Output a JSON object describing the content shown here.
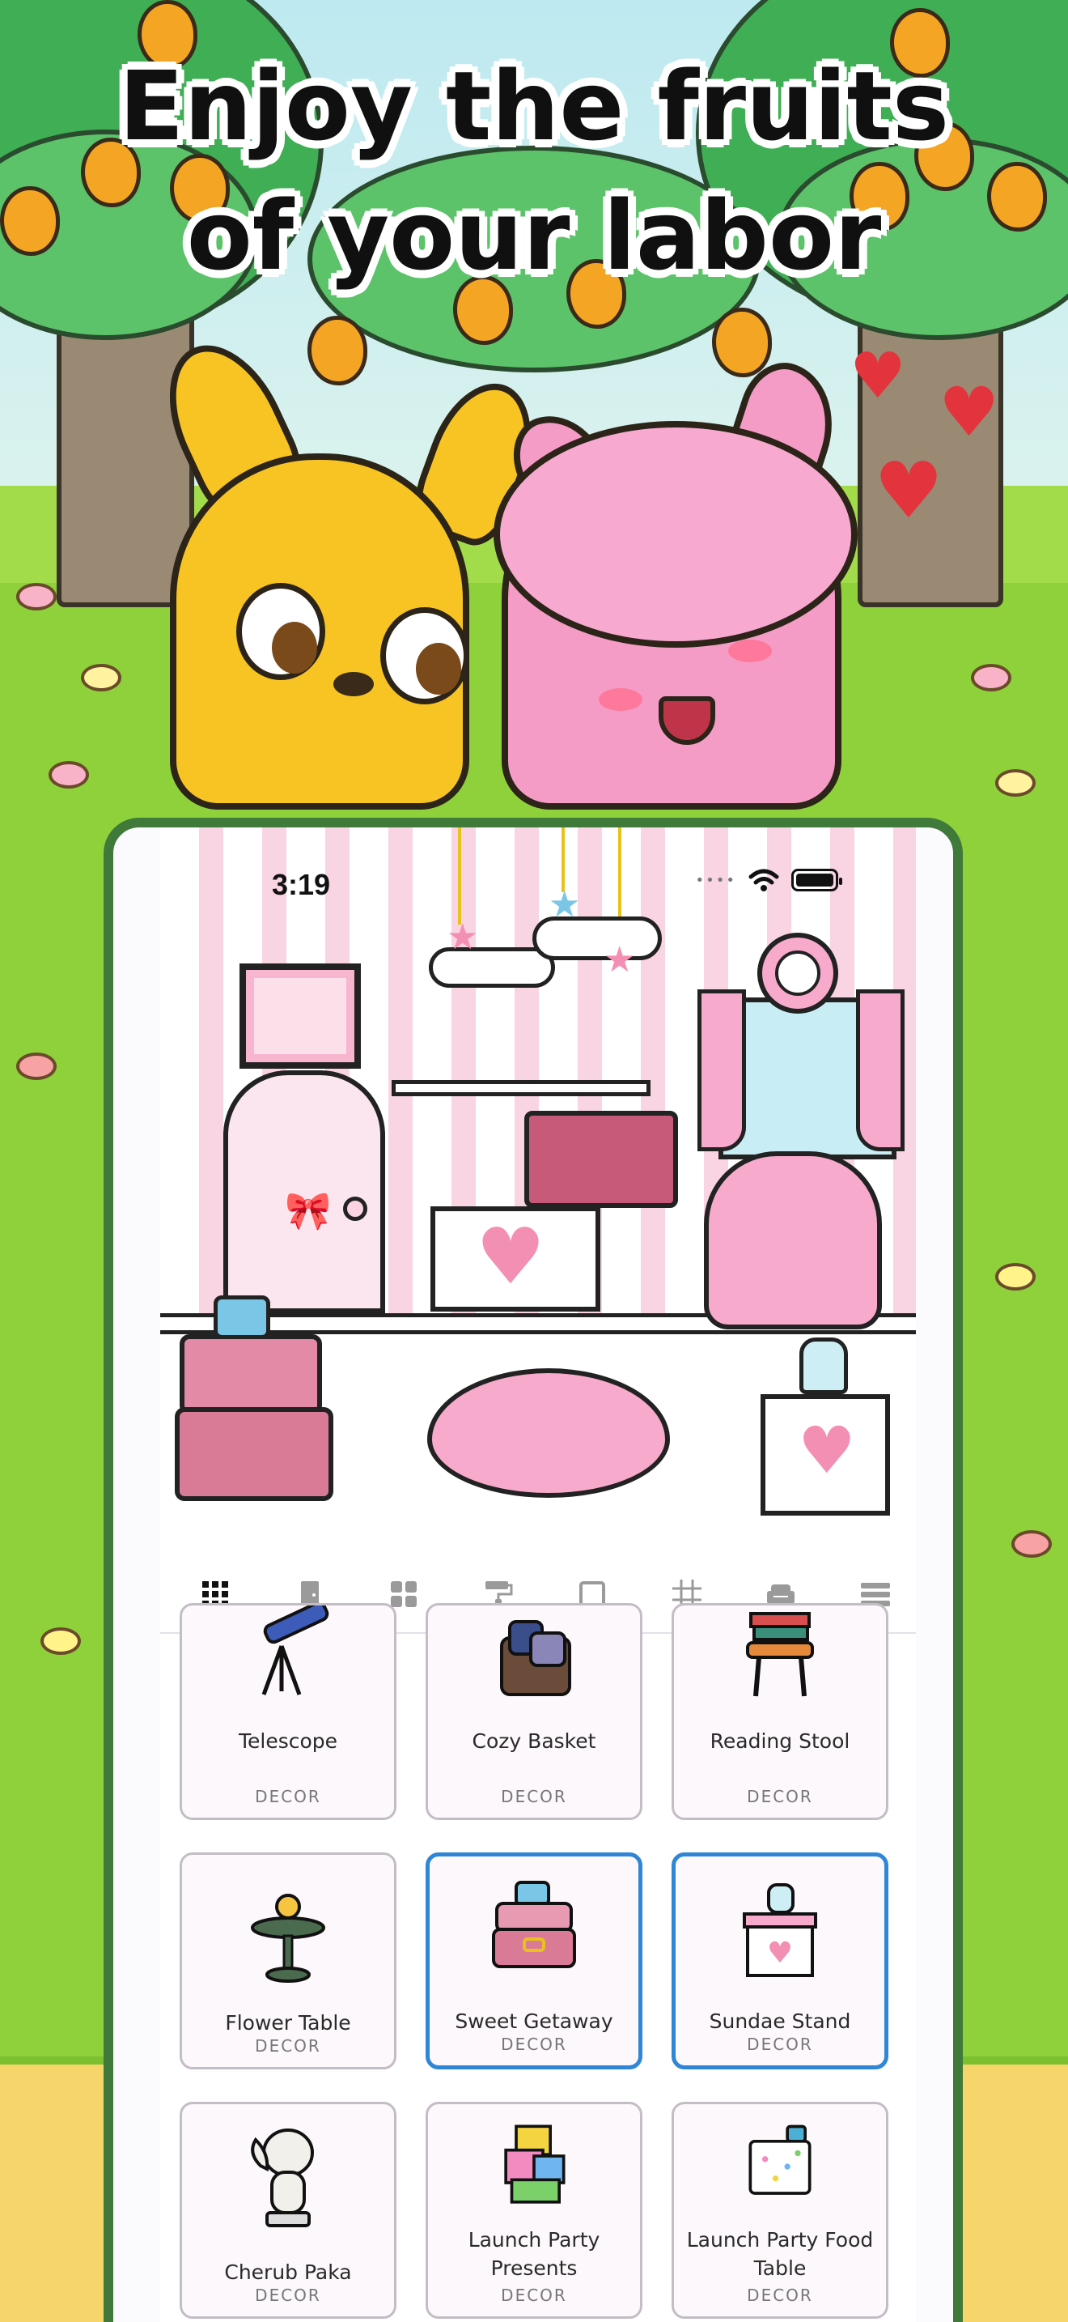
{
  "headline": {
    "line1": "Enjoy the fruits",
    "line2": "of your labor"
  },
  "status_bar": {
    "time": "3:19"
  },
  "tabs": [
    {
      "icon": "grid-icon",
      "selected": true
    },
    {
      "icon": "door-icon",
      "selected": false
    },
    {
      "icon": "window-icon",
      "selected": false
    },
    {
      "icon": "paint-roller-icon",
      "selected": false
    },
    {
      "icon": "square-icon",
      "selected": false
    },
    {
      "icon": "floor-grid-icon",
      "selected": false
    },
    {
      "icon": "sofa-icon",
      "selected": false
    },
    {
      "icon": "list-icon",
      "selected": false
    }
  ],
  "items": [
    {
      "name": "Telescope",
      "category": "DECOR",
      "selected": false
    },
    {
      "name": "Cozy Basket",
      "category": "DECOR",
      "selected": false
    },
    {
      "name": "Reading Stool",
      "category": "DECOR",
      "selected": false
    },
    {
      "name": "Flower Table",
      "category": "DECOR",
      "selected": false
    },
    {
      "name": "Sweet Getaway",
      "category": "DECOR",
      "selected": true
    },
    {
      "name": "Sundae Stand",
      "category": "DECOR",
      "selected": true
    },
    {
      "name": "Cherub Paka",
      "category": "DECOR",
      "selected": false
    },
    {
      "name": "Launch Party Presents",
      "category": "DECOR",
      "selected": false
    },
    {
      "name": "Launch Party Food Table",
      "category": "DECOR",
      "selected": false
    }
  ],
  "colors": {
    "accent_selected": "#2f86d6",
    "tab_indicator": "#5a4fa8",
    "grass": "#8fd13a",
    "frame_green": "#3f7a3a"
  }
}
